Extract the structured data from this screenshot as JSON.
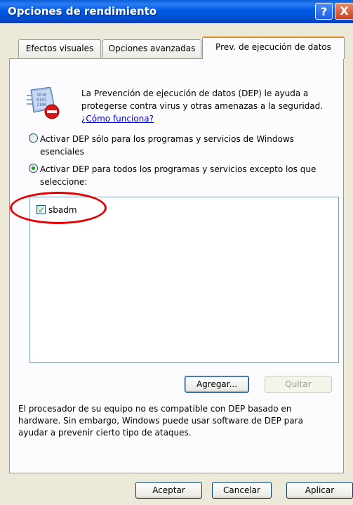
{
  "window": {
    "title": "Opciones de rendimiento",
    "help_label": "?",
    "close_label": "X"
  },
  "tabs": [
    {
      "label": "Efectos visuales"
    },
    {
      "label": "Opciones avanzadas"
    },
    {
      "label": "Prev. de ejecución de datos",
      "active": true
    }
  ],
  "dep": {
    "intro_text": "La Prevención de ejecución de datos (DEP) le ayuda a protegerse contra virus y otras amenazas a la seguridad.",
    "link_text": "¿Cómo funciona?",
    "options": [
      {
        "label": "Activar DEP sólo para los programas y servicios de Windows esenciales",
        "selected": false
      },
      {
        "label": "Activar DEP para todos los programas y servicios excepto los que seleccione:",
        "selected": true
      }
    ],
    "exceptions": [
      {
        "label": "sbadm",
        "checked": true
      }
    ],
    "add_button": "Agregar...",
    "remove_button": "Quitar",
    "note": "El procesador de su equipo no es compatible con DEP basado en hardware. Sin embargo, Windows puede usar software de DEP para ayudar a prevenir cierto tipo de ataques."
  },
  "footer": {
    "ok": "Aceptar",
    "cancel": "Cancelar",
    "apply": "Aplicar"
  },
  "colors": {
    "titlebar": "#0058e6",
    "highlight_ring": "#e60000",
    "active_tab_accent": "#e68b2c",
    "link": "#0000cc"
  },
  "icons": {
    "dep": "dep-shield-icon",
    "help": "help-icon",
    "close": "close-icon",
    "check": "checkmark-icon"
  }
}
